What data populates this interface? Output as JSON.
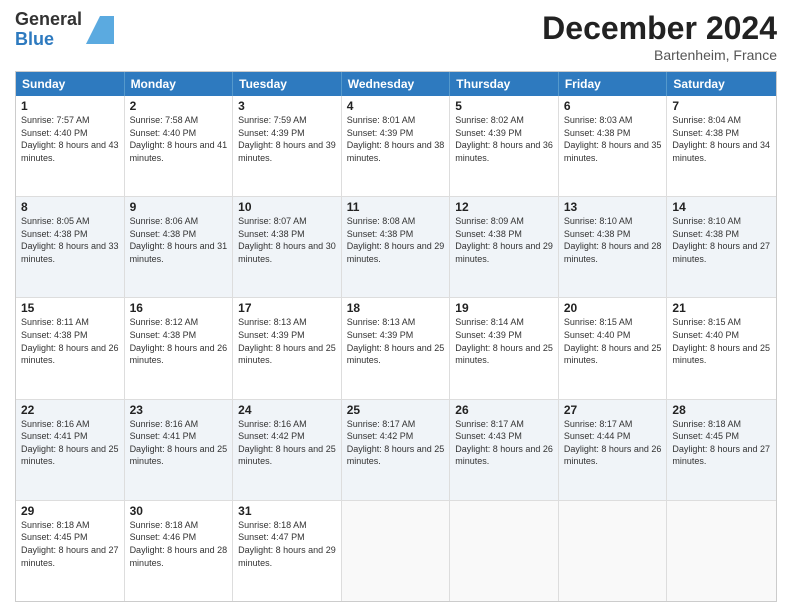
{
  "logo": {
    "general": "General",
    "blue": "Blue"
  },
  "title": "December 2024",
  "location": "Bartenheim, France",
  "header": {
    "days": [
      "Sunday",
      "Monday",
      "Tuesday",
      "Wednesday",
      "Thursday",
      "Friday",
      "Saturday"
    ]
  },
  "weeks": [
    [
      {
        "day": "1",
        "sunrise": "7:57 AM",
        "sunset": "4:40 PM",
        "daylight": "8 hours and 43 minutes."
      },
      {
        "day": "2",
        "sunrise": "7:58 AM",
        "sunset": "4:40 PM",
        "daylight": "8 hours and 41 minutes."
      },
      {
        "day": "3",
        "sunrise": "7:59 AM",
        "sunset": "4:39 PM",
        "daylight": "8 hours and 39 minutes."
      },
      {
        "day": "4",
        "sunrise": "8:01 AM",
        "sunset": "4:39 PM",
        "daylight": "8 hours and 38 minutes."
      },
      {
        "day": "5",
        "sunrise": "8:02 AM",
        "sunset": "4:39 PM",
        "daylight": "8 hours and 36 minutes."
      },
      {
        "day": "6",
        "sunrise": "8:03 AM",
        "sunset": "4:38 PM",
        "daylight": "8 hours and 35 minutes."
      },
      {
        "day": "7",
        "sunrise": "8:04 AM",
        "sunset": "4:38 PM",
        "daylight": "8 hours and 34 minutes."
      }
    ],
    [
      {
        "day": "8",
        "sunrise": "8:05 AM",
        "sunset": "4:38 PM",
        "daylight": "8 hours and 33 minutes."
      },
      {
        "day": "9",
        "sunrise": "8:06 AM",
        "sunset": "4:38 PM",
        "daylight": "8 hours and 31 minutes."
      },
      {
        "day": "10",
        "sunrise": "8:07 AM",
        "sunset": "4:38 PM",
        "daylight": "8 hours and 30 minutes."
      },
      {
        "day": "11",
        "sunrise": "8:08 AM",
        "sunset": "4:38 PM",
        "daylight": "8 hours and 29 minutes."
      },
      {
        "day": "12",
        "sunrise": "8:09 AM",
        "sunset": "4:38 PM",
        "daylight": "8 hours and 29 minutes."
      },
      {
        "day": "13",
        "sunrise": "8:10 AM",
        "sunset": "4:38 PM",
        "daylight": "8 hours and 28 minutes."
      },
      {
        "day": "14",
        "sunrise": "8:10 AM",
        "sunset": "4:38 PM",
        "daylight": "8 hours and 27 minutes."
      }
    ],
    [
      {
        "day": "15",
        "sunrise": "8:11 AM",
        "sunset": "4:38 PM",
        "daylight": "8 hours and 26 minutes."
      },
      {
        "day": "16",
        "sunrise": "8:12 AM",
        "sunset": "4:38 PM",
        "daylight": "8 hours and 26 minutes."
      },
      {
        "day": "17",
        "sunrise": "8:13 AM",
        "sunset": "4:39 PM",
        "daylight": "8 hours and 25 minutes."
      },
      {
        "day": "18",
        "sunrise": "8:13 AM",
        "sunset": "4:39 PM",
        "daylight": "8 hours and 25 minutes."
      },
      {
        "day": "19",
        "sunrise": "8:14 AM",
        "sunset": "4:39 PM",
        "daylight": "8 hours and 25 minutes."
      },
      {
        "day": "20",
        "sunrise": "8:15 AM",
        "sunset": "4:40 PM",
        "daylight": "8 hours and 25 minutes."
      },
      {
        "day": "21",
        "sunrise": "8:15 AM",
        "sunset": "4:40 PM",
        "daylight": "8 hours and 25 minutes."
      }
    ],
    [
      {
        "day": "22",
        "sunrise": "8:16 AM",
        "sunset": "4:41 PM",
        "daylight": "8 hours and 25 minutes."
      },
      {
        "day": "23",
        "sunrise": "8:16 AM",
        "sunset": "4:41 PM",
        "daylight": "8 hours and 25 minutes."
      },
      {
        "day": "24",
        "sunrise": "8:16 AM",
        "sunset": "4:42 PM",
        "daylight": "8 hours and 25 minutes."
      },
      {
        "day": "25",
        "sunrise": "8:17 AM",
        "sunset": "4:42 PM",
        "daylight": "8 hours and 25 minutes."
      },
      {
        "day": "26",
        "sunrise": "8:17 AM",
        "sunset": "4:43 PM",
        "daylight": "8 hours and 26 minutes."
      },
      {
        "day": "27",
        "sunrise": "8:17 AM",
        "sunset": "4:44 PM",
        "daylight": "8 hours and 26 minutes."
      },
      {
        "day": "28",
        "sunrise": "8:18 AM",
        "sunset": "4:45 PM",
        "daylight": "8 hours and 27 minutes."
      }
    ],
    [
      {
        "day": "29",
        "sunrise": "8:18 AM",
        "sunset": "4:45 PM",
        "daylight": "8 hours and 27 minutes."
      },
      {
        "day": "30",
        "sunrise": "8:18 AM",
        "sunset": "4:46 PM",
        "daylight": "8 hours and 28 minutes."
      },
      {
        "day": "31",
        "sunrise": "8:18 AM",
        "sunset": "4:47 PM",
        "daylight": "8 hours and 29 minutes."
      },
      null,
      null,
      null,
      null
    ]
  ]
}
